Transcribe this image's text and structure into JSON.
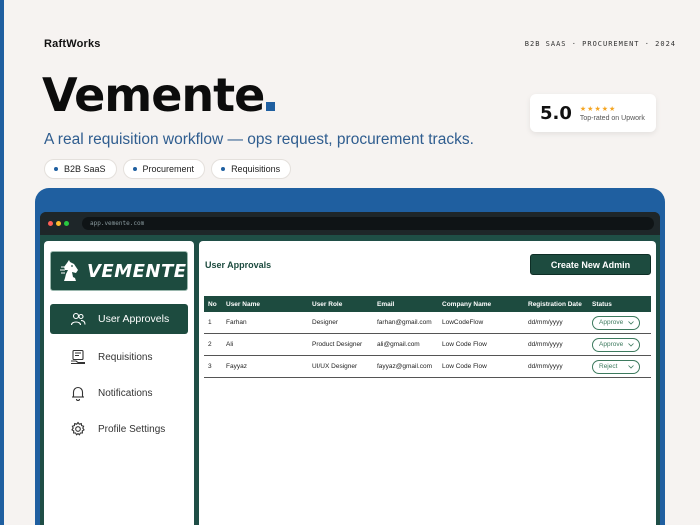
{
  "header": {
    "brand": "RaftWorks",
    "meta": "B2B SAAS · PROCUREMENT · 2024",
    "title": "Vemente",
    "subtitle": "A real requisition workflow — ops request, procurement tracks.",
    "tags": [
      "B2B SaaS",
      "Procurement",
      "Requisitions"
    ]
  },
  "rating": {
    "score": "5.0",
    "stars": "★★★★★",
    "label": "Top-rated on Upwork"
  },
  "browser": {
    "url": "app.vemente.com"
  },
  "sidebar": {
    "logo_text": "VEMENTE",
    "items": [
      {
        "label": "User Approvels",
        "icon": "users-icon",
        "active": true
      },
      {
        "label": "Requisitions",
        "icon": "requisitions-icon",
        "active": false
      },
      {
        "label": "Notifications",
        "icon": "bell-icon",
        "active": false
      },
      {
        "label": "Profile Settings",
        "icon": "gear-icon",
        "active": false
      }
    ]
  },
  "main": {
    "title": "User Approvals",
    "create_button": "Create New Admin",
    "columns": [
      "No",
      "User Name",
      "User Role",
      "Email",
      "Company Name",
      "Registration Date",
      "Status"
    ],
    "rows": [
      {
        "no": "1",
        "name": "Farhan",
        "role": "Designer",
        "email": "farhan@gmail.com",
        "company": "LowCodeFlow",
        "date": "dd/mm/yyyy",
        "status": "Approve"
      },
      {
        "no": "2",
        "name": "Ali",
        "role": "Product Designer",
        "email": "ali@gmail.com",
        "company": "Low Code Flow",
        "date": "dd/mm/yyyy",
        "status": "Approve"
      },
      {
        "no": "3",
        "name": "Fayyaz",
        "role": "UI/UX Designer",
        "email": "fayyaz@gmail.com",
        "company": "Low Code Flow",
        "date": "dd/mm/yyyy",
        "status": "Reject"
      }
    ]
  },
  "colors": {
    "accent": "#1f5fa0",
    "brand_green": "#1d4b3f"
  }
}
